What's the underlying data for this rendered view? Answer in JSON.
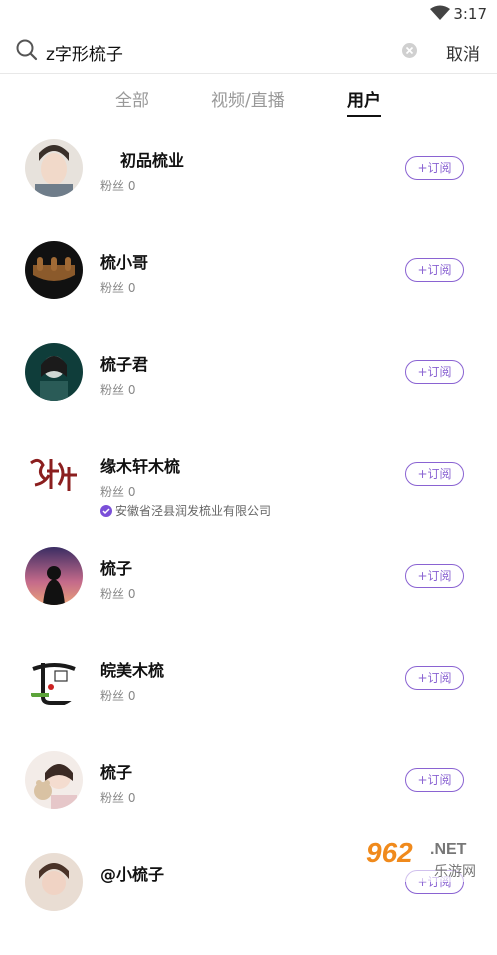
{
  "status_bar": {
    "time": "3:17"
  },
  "search": {
    "query": "z字形梳子",
    "cancel_label": "取消"
  },
  "tabs": [
    {
      "label": "全部",
      "active": false
    },
    {
      "label": "视频/直播",
      "active": false
    },
    {
      "label": "用户",
      "active": true
    }
  ],
  "users": [
    {
      "name": "初品梳业",
      "fans": "粉丝 0",
      "subscribe": "+订阅",
      "verified": ""
    },
    {
      "name": "梳小哥",
      "fans": "粉丝 0",
      "subscribe": "+订阅",
      "verified": ""
    },
    {
      "name": "梳子君",
      "fans": "粉丝 0",
      "subscribe": "+订阅",
      "verified": ""
    },
    {
      "name": "缘木轩木梳",
      "fans": "粉丝 0",
      "subscribe": "+订阅",
      "verified": "安徽省泾县润发梳业有限公司"
    },
    {
      "name": "梳子",
      "fans": "粉丝 0",
      "subscribe": "+订阅",
      "verified": ""
    },
    {
      "name": "皖美木梳",
      "fans": "粉丝 0",
      "subscribe": "+订阅",
      "verified": ""
    },
    {
      "name": "梳子",
      "fans": "粉丝 0",
      "subscribe": "+订阅",
      "verified": ""
    },
    {
      "name": "@小梳子",
      "fans": "",
      "subscribe": "+订阅",
      "verified": ""
    }
  ],
  "watermark": {
    "brand": "962.NET",
    "sub": "乐游网"
  },
  "colors": {
    "accent": "#8a63d2",
    "verified": "#7a4fd8"
  }
}
